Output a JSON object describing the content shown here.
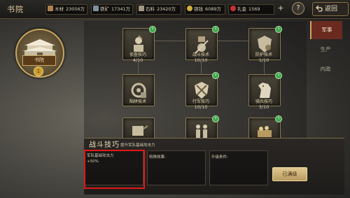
{
  "title": "书院",
  "resources": [
    {
      "name": "木材",
      "value": "23056万",
      "icon": "wood-icon",
      "color": "#b08050"
    },
    {
      "name": "铁矿",
      "value": "17341万",
      "icon": "iron-icon",
      "color": "#8090a0"
    },
    {
      "name": "石料",
      "value": "23420万",
      "icon": "stone-icon",
      "color": "#a09880"
    },
    {
      "name": "铜钱",
      "value": "6089万",
      "icon": "coin-icon",
      "color": "#d0b040"
    },
    {
      "name": "礼金",
      "value": "1569",
      "icon": "gift-money-icon",
      "color": "#c83030"
    }
  ],
  "plus_label": "+",
  "help_label": "?",
  "back_label": "返回",
  "building": {
    "name": "书院",
    "level_badge": "1"
  },
  "tabs": [
    {
      "label": "军事",
      "active": true
    },
    {
      "label": "生产",
      "active": false
    },
    {
      "label": "内政",
      "active": false
    }
  ],
  "techs": [
    {
      "name": "侦查技巧",
      "progress": "4/10",
      "badge": true,
      "icon": "scout-icon"
    },
    {
      "name": "战斗技术",
      "progress": "10/10",
      "badge": true,
      "icon": "battle-icon"
    },
    {
      "name": "防护技术",
      "progress": "1/10",
      "badge": true,
      "icon": "defense-icon"
    },
    {
      "name": "陷阱技术",
      "progress": "",
      "badge": false,
      "icon": "trap-icon"
    },
    {
      "name": "行军技巧",
      "progress": "10/10",
      "badge": true,
      "icon": "march-icon"
    },
    {
      "name": "骑兵技巧",
      "progress": "3/10",
      "badge": true,
      "icon": "cavalry-icon"
    },
    {
      "name": "",
      "progress": "",
      "badge": false,
      "icon": "siege-icon"
    },
    {
      "name": "",
      "progress": "",
      "badge": true,
      "icon": "soldiers-icon"
    },
    {
      "name": "",
      "progress": "",
      "badge": true,
      "icon": "treasure-icon"
    }
  ],
  "detail": {
    "title": "战斗技巧",
    "description": "提升军队基础攻击力",
    "effect_label": "军队基础攻击力",
    "effect_value": "+50%",
    "special_label": "特殊效果:",
    "upgrade_label": "升级条件:",
    "max_button": "已满级"
  }
}
